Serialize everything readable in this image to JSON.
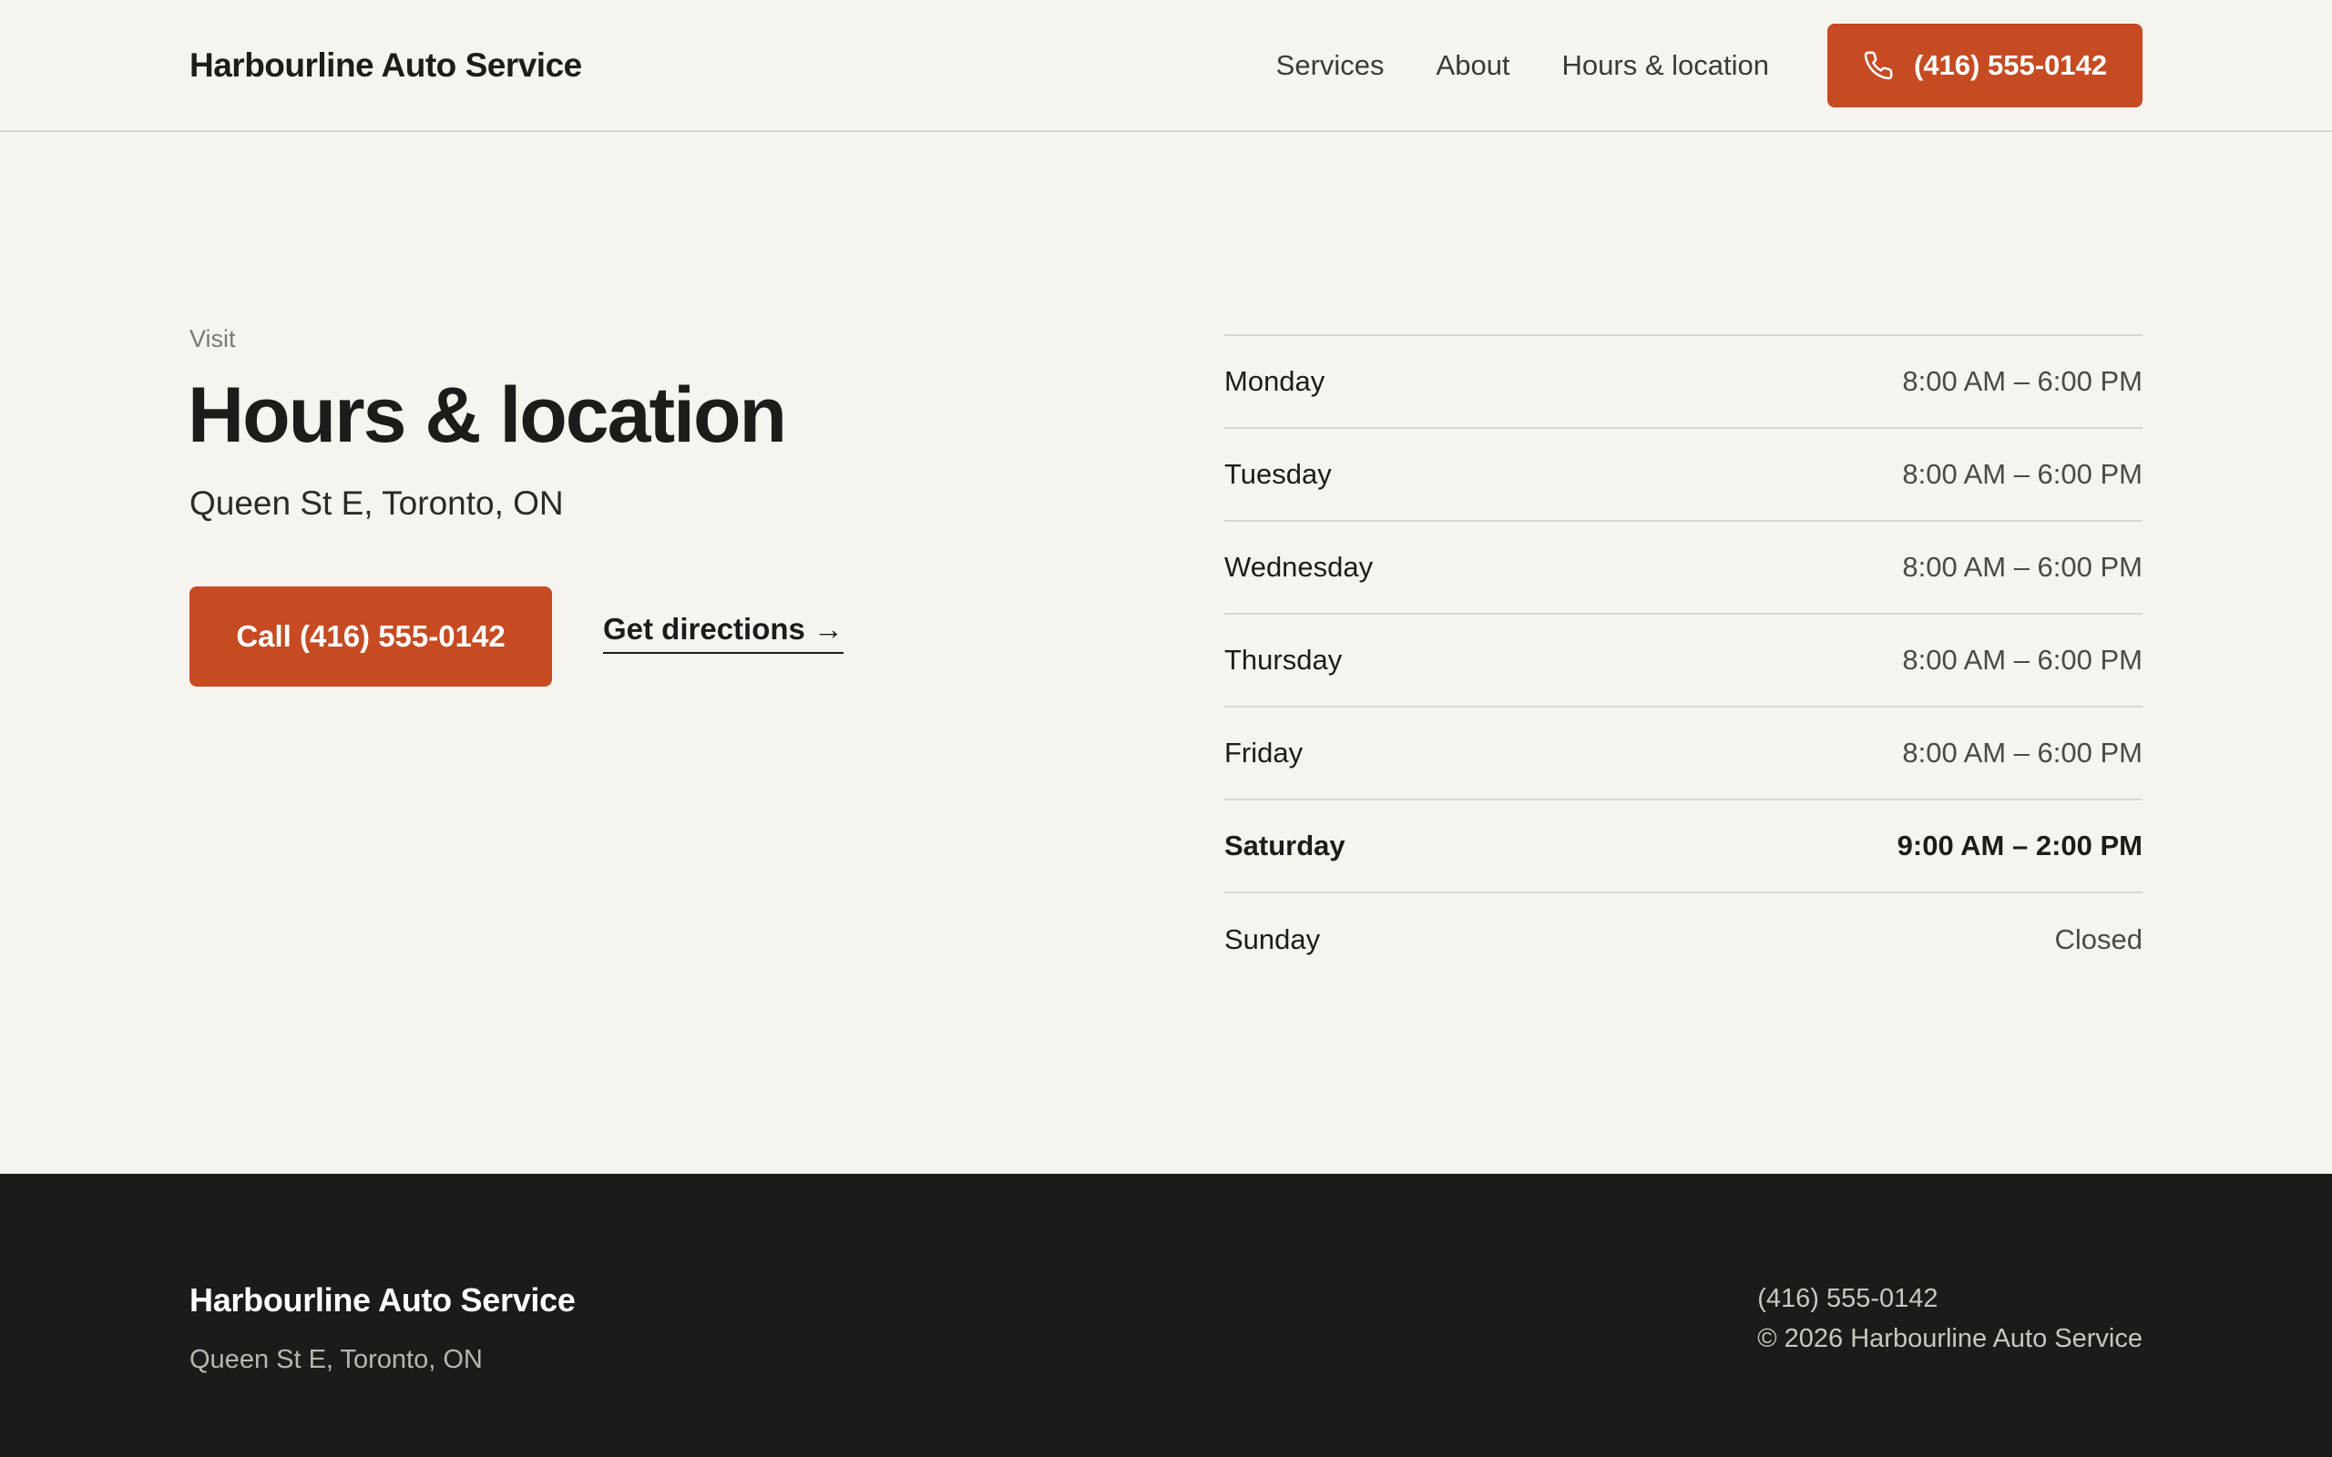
{
  "header": {
    "brand": "Harbourline Auto Service",
    "nav": [
      {
        "label": "Services"
      },
      {
        "label": "About"
      },
      {
        "label": "Hours & location"
      }
    ],
    "call_label": "(416) 555-0142",
    "call_icon": "phone-icon"
  },
  "main": {
    "eyebrow": "Visit",
    "title": "Hours & location",
    "address": "Queen St E, Toronto, ON",
    "call_button": "Call (416) 555-0142",
    "directions_link": "Get directions →",
    "hours": [
      {
        "day": "Monday",
        "time": "8:00 AM – 6:00 PM"
      },
      {
        "day": "Tuesday",
        "time": "8:00 AM – 6:00 PM"
      },
      {
        "day": "Wednesday",
        "time": "8:00 AM – 6:00 PM"
      },
      {
        "day": "Thursday",
        "time": "8:00 AM – 6:00 PM"
      },
      {
        "day": "Friday",
        "time": "8:00 AM – 6:00 PM"
      },
      {
        "day": "Saturday",
        "time": "9:00 AM – 2:00 PM",
        "highlight": true
      },
      {
        "day": "Sunday",
        "time": "Closed"
      }
    ]
  },
  "footer": {
    "brand": "Harbourline Auto Service",
    "address": "Queen St E, Toronto, ON",
    "phone": "(416) 555-0142",
    "copyright": "© 2026 Harbourline Auto Service"
  },
  "colors": {
    "accent": "#c64b22",
    "background": "#f6f4ef",
    "footer_bg": "#1b1b19"
  }
}
